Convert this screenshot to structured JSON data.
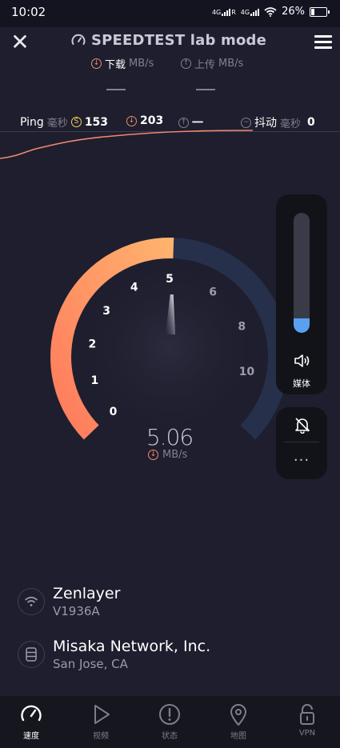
{
  "status_bar": {
    "time": "10:02",
    "net1": "4G",
    "net2": "R",
    "net3": "4G",
    "battery": "26%"
  },
  "header": {
    "title": "SPEEDTEST lab mode",
    "download_label": "下载",
    "upload_label": "上传",
    "unit": "MB/s"
  },
  "ping": {
    "label": "Ping",
    "unit": "毫秒",
    "idle_value": "153",
    "download_value": "203",
    "upload_value": "一",
    "jitter_label": "抖动",
    "jitter_unit": "毫秒",
    "jitter_value": "0"
  },
  "gauge": {
    "ticks": [
      "0",
      "1",
      "2",
      "3",
      "4",
      "5",
      "6",
      "8",
      "10"
    ],
    "value": "5.06",
    "unit": "MB/s",
    "reading": 5.06,
    "max": 10
  },
  "volume_panel": {
    "media_label": "媒体",
    "level": 0.12,
    "more": "···"
  },
  "servers": [
    {
      "name": "Zenlayer",
      "sub": "V1936A",
      "icon": "wifi-icon"
    },
    {
      "name": "Misaka Network, Inc.",
      "sub": "San Jose, CA",
      "icon": "server-icon"
    }
  ],
  "nav": {
    "items": [
      {
        "label": "速度",
        "icon": "speedometer-icon"
      },
      {
        "label": "视频",
        "icon": "play-icon"
      },
      {
        "label": "状态",
        "icon": "alert-icon"
      },
      {
        "label": "地图",
        "icon": "map-pin-icon"
      },
      {
        "label": "VPN",
        "icon": "lock-icon"
      }
    ]
  },
  "colors": {
    "download": "#f08a6e",
    "upload": "#80818f",
    "gauge_orange": "#ffa36c",
    "gauge_track": "#26304a",
    "volume": "#5aa0f0"
  }
}
